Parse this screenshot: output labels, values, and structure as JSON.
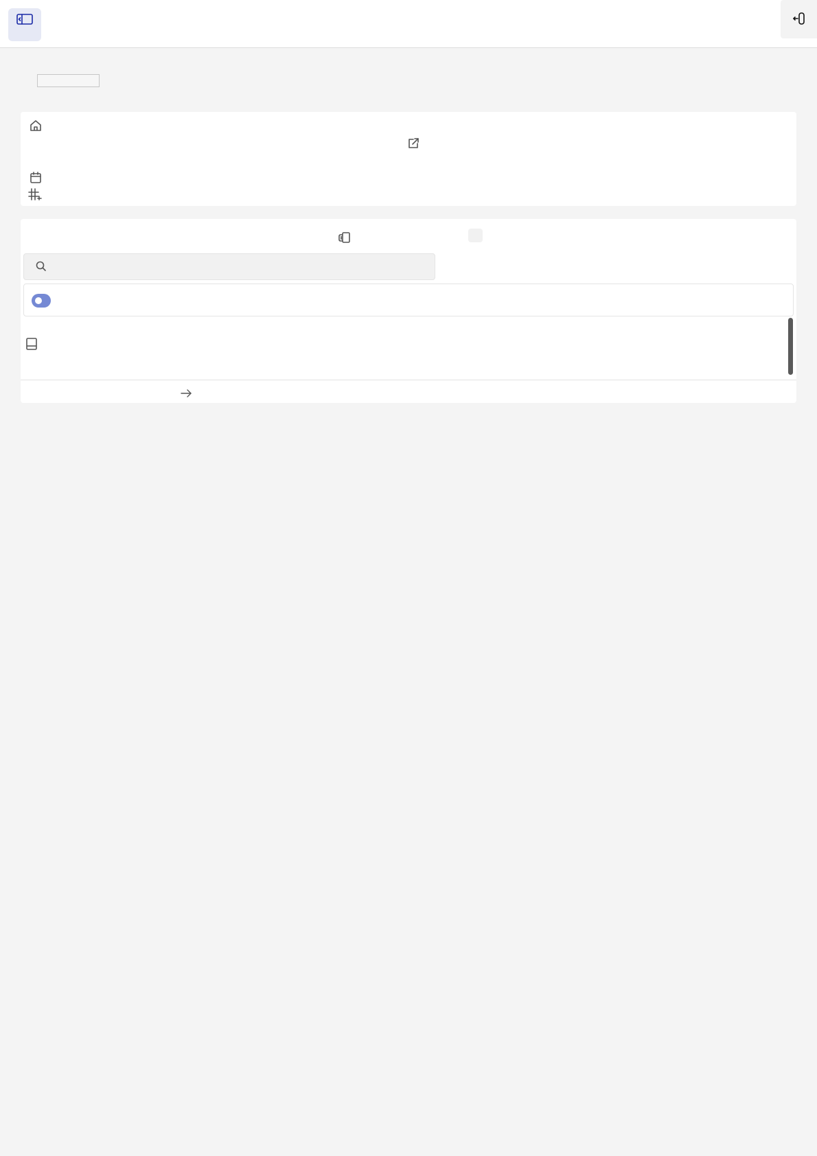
{
  "header": {
    "sidebar_toggle_icon": "sidebar-panel-icon",
    "logout_icon": "logout-icon",
    "accent": "#1a2aa6"
  },
  "page": {
    "title": ""
  },
  "info_card": {
    "icons": [
      "home-icon",
      "external-link-icon",
      "calendar-icon",
      "hashtag-icon"
    ]
  },
  "main_card": {
    "view_icon": "copy-pages-icon",
    "search": {
      "icon": "search-icon",
      "value": "",
      "placeholder": ""
    },
    "filter_toggle": {
      "on": true,
      "color": "#7589d4"
    },
    "list_item_icon": "book-icon",
    "footer_icon": "arrow-right-icon"
  }
}
